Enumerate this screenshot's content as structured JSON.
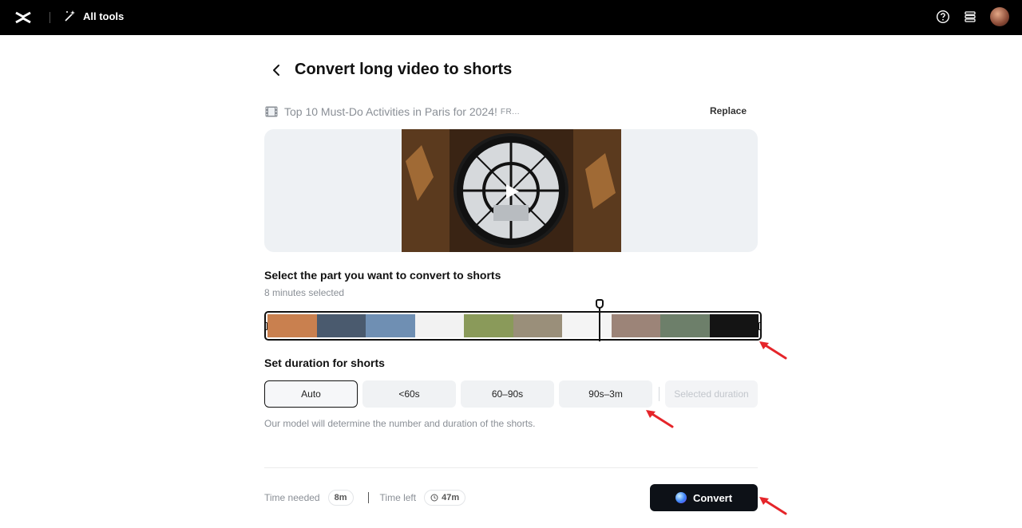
{
  "topbar": {
    "logo_icon": "capcut-logo-icon",
    "all_tools_label": "All tools",
    "help_icon": "help-circle-icon",
    "layers_icon": "layers-icon"
  },
  "header": {
    "title": "Convert long video to shorts"
  },
  "file": {
    "name": "Top 10 Must-Do Activities in Paris for 2024!",
    "suffix": "FR...",
    "replace_label": "Replace"
  },
  "selection": {
    "title": "Select the part you want to convert to shorts",
    "subtitle": "8 minutes selected",
    "frame_colors": [
      "#c9804f",
      "#4a5a6e",
      "#6f8fb3",
      "#f2f2f2",
      "#8a9a5a",
      "#9a8f7a",
      "#f4f4f4",
      "#9c8478",
      "#6d7f6a",
      "#141414"
    ],
    "playhead_position": 0.68
  },
  "duration": {
    "title": "Set duration for shorts",
    "options": [
      "Auto",
      "<60s",
      "60–90s",
      "90s–3m"
    ],
    "selected": "Auto",
    "custom_label": "Selected duration",
    "hint": "Our model will determine the number and duration of the shorts."
  },
  "footer": {
    "time_needed_label": "Time needed",
    "time_needed_value": "8m",
    "time_left_label": "Time left",
    "time_left_value": "47m",
    "convert_label": "Convert"
  },
  "colors": {
    "accent": "#000000",
    "annotation": "#e5252a"
  }
}
